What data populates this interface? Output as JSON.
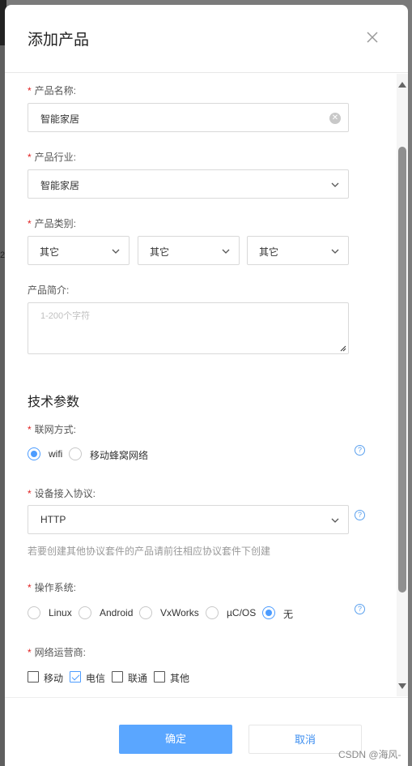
{
  "modal": {
    "title": "添加产品",
    "close_icon": "close-icon"
  },
  "form": {
    "product_name": {
      "label": "产品名称:",
      "value": "智能家居"
    },
    "industry": {
      "label": "产品行业:",
      "value": "智能家居"
    },
    "category": {
      "label": "产品类别:",
      "values": [
        "其它",
        "其它",
        "其它"
      ]
    },
    "intro": {
      "label": "产品简介:",
      "placeholder": "1-200个字符"
    }
  },
  "tech": {
    "section_title": "技术参数",
    "network": {
      "label": "联网方式:",
      "options": [
        "wifi",
        "移动蜂窝网络"
      ],
      "selected": "wifi"
    },
    "protocol": {
      "label": "设备接入协议:",
      "value": "HTTP",
      "hint": "若要创建其他协议套件的产品请前往相应协议套件下创建"
    },
    "os": {
      "label": "操作系统:",
      "options": [
        "Linux",
        "Android",
        "VxWorks",
        "µC/OS",
        "无"
      ],
      "selected": "无"
    },
    "carrier": {
      "label": "网络运营商:",
      "options": [
        "移动",
        "电信",
        "联通",
        "其他"
      ],
      "checked": [
        "电信"
      ]
    }
  },
  "footer": {
    "ok_label": "确定",
    "cancel_label": "取消"
  },
  "watermark": "CSDN @海风-",
  "edge_char": "2",
  "colors": {
    "accent": "#4c9cff",
    "required": "#e02020",
    "primary_button": "#5aa6ff"
  }
}
